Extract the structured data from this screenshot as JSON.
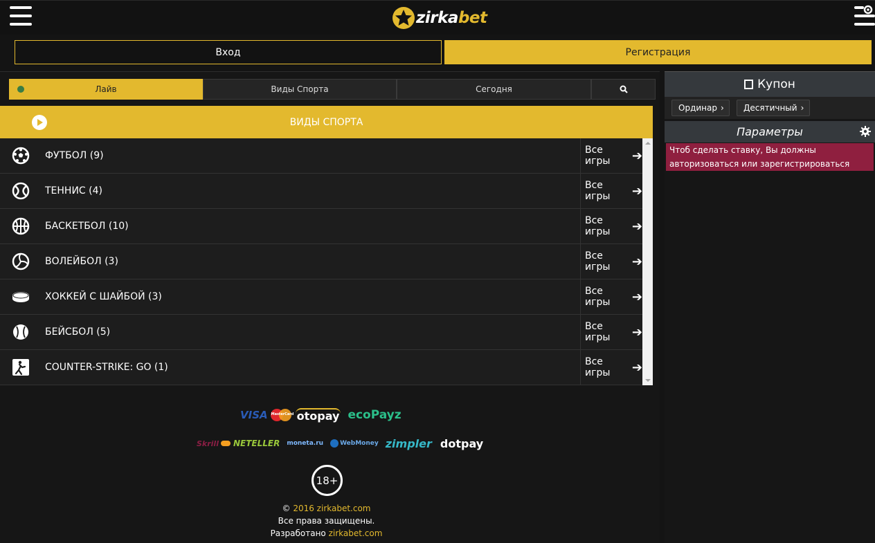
{
  "header": {
    "logo_main": "zirka",
    "logo_accent": "bet",
    "login_label": "Вход",
    "register_label": "Регистрация"
  },
  "tabs": {
    "live": "Лайв",
    "sports": "Виды Спорта",
    "today": "Сегодня"
  },
  "section_title": "ВИДЫ СПОРТА",
  "sports": [
    {
      "name": "ФУТБОЛ (9)",
      "icon": "soccer-ball-icon",
      "all_label": "Все игры"
    },
    {
      "name": "ТЕННИС (4)",
      "icon": "tennis-ball-icon",
      "all_label": "Все игры"
    },
    {
      "name": "БАСКЕТБОЛ (10)",
      "icon": "basketball-icon",
      "all_label": "Все игры"
    },
    {
      "name": "ВОЛЕЙБОЛ (3)",
      "icon": "volleyball-icon",
      "all_label": "Все игры"
    },
    {
      "name": "ХОККЕЙ С ШАЙБОЙ (3)",
      "icon": "hockey-puck-icon",
      "all_label": "Все игры"
    },
    {
      "name": "БЕЙСБОЛ (5)",
      "icon": "baseball-icon",
      "all_label": "Все игры"
    },
    {
      "name": "COUNTER-STRIKE: GO (1)",
      "icon": "counter-strike-icon",
      "all_label": "Все игры"
    }
  ],
  "payments_row1": [
    "VISA",
    "MasterCard",
    "otopay",
    "ecoPayz"
  ],
  "payments_row2": [
    "Skrill",
    "NETELLER",
    "moneta.ru",
    "WebMoney",
    "zimpler",
    "dotpay"
  ],
  "footer": {
    "age": "18+",
    "copyright_prefix": "©",
    "copyright_year_site": "2016 zirkabet.com",
    "rights": "Все права защищены.",
    "dev_prefix": "Разработано",
    "dev_site": "zirkabet.com"
  },
  "coupon": {
    "title": "Купон",
    "ordinar": "Ординар",
    "decimal": "Десятичный",
    "params_title": "Параметры",
    "alert": "Чтоб сделать ставку, Вы должны авторизоваться или зарегистрироваться"
  },
  "colors": {
    "accent": "#e3b92e",
    "alert": "#8f1f3f",
    "panel_header": "#35393d"
  }
}
